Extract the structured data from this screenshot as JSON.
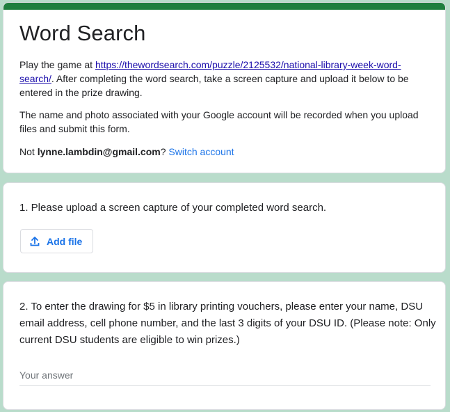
{
  "form": {
    "title": "Word Search",
    "description_prefix": "Play the game at ",
    "game_link": "https://thewordsearch.com/puzzle/2125532/national-library-week-word-search/",
    "description_suffix": ". After completing the word search, take a screen capture and upload it below to be entered in the prize drawing.",
    "privacy_notice": "The name and photo associated with your Google account will be recorded when you upload files and submit this form.",
    "account_prefix": "Not ",
    "account_email": "lynne.lambdin@gmail.com",
    "account_suffix": "? ",
    "switch_account": "Switch account"
  },
  "questions": [
    {
      "text": "1. Please upload a screen capture of your completed word search.",
      "add_file_label": "Add file",
      "icon": "upload-icon"
    },
    {
      "text": "2. To enter the drawing for $5 in library printing vouchers, please enter your name, DSU email address, cell phone number, and the last 3 digits of your DSU ID. (Please note: Only current DSU students are eligible to win prizes.)",
      "placeholder": "Your answer"
    }
  ],
  "colors": {
    "header_stripe": "#1e7e3e",
    "background": "#b9dccb",
    "accent": "#1a73e8"
  }
}
